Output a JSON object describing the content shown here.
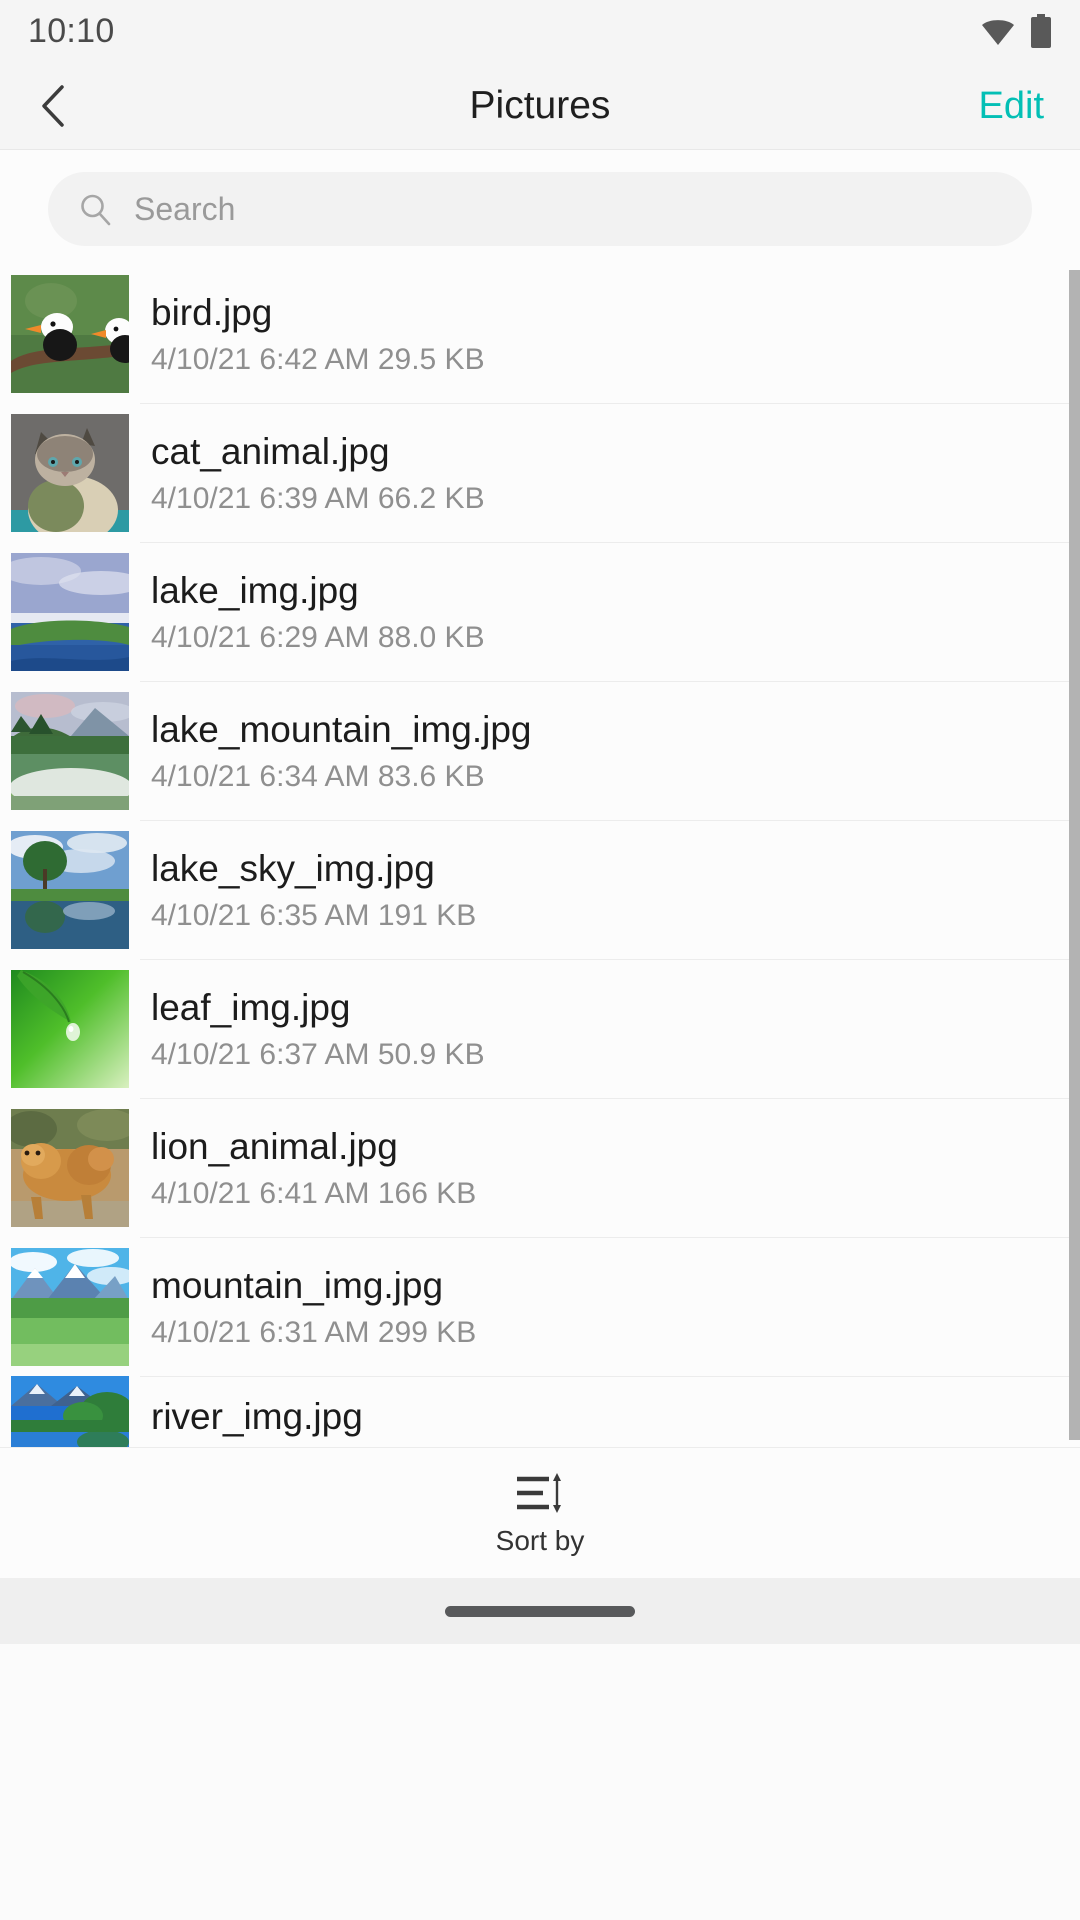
{
  "status_bar": {
    "time": "10:10",
    "wifi_icon": "wifi-icon",
    "battery_icon": "battery-full-icon"
  },
  "app_bar": {
    "back_icon": "back-chevron-icon",
    "title": "Pictures",
    "edit_label": "Edit",
    "accent_color": "#03bfb5"
  },
  "search": {
    "icon": "search-icon",
    "placeholder": "Search",
    "value": ""
  },
  "files": [
    {
      "name": "bird.jpg",
      "meta": "4/10/21 6:42 AM 29.5 KB",
      "date": "4/10/21",
      "time": "6:42 AM",
      "size": "29.5 KB",
      "thumb": "bird-thumbnail"
    },
    {
      "name": "cat_animal.jpg",
      "meta": "4/10/21 6:39 AM 66.2 KB",
      "date": "4/10/21",
      "time": "6:39 AM",
      "size": "66.2 KB",
      "thumb": "cat-thumbnail"
    },
    {
      "name": "lake_img.jpg",
      "meta": "4/10/21 6:29 AM 88.0 KB",
      "date": "4/10/21",
      "time": "6:29 AM",
      "size": "88.0 KB",
      "thumb": "lake-thumbnail"
    },
    {
      "name": "lake_mountain_img.jpg",
      "meta": "4/10/21 6:34 AM 83.6 KB",
      "date": "4/10/21",
      "time": "6:34 AM",
      "size": "83.6 KB",
      "thumb": "lake-mountain-thumbnail"
    },
    {
      "name": "lake_sky_img.jpg",
      "meta": "4/10/21 6:35 AM 191 KB",
      "date": "4/10/21",
      "time": "6:35 AM",
      "size": "191 KB",
      "thumb": "lake-sky-thumbnail"
    },
    {
      "name": "leaf_img.jpg",
      "meta": "4/10/21 6:37 AM 50.9 KB",
      "date": "4/10/21",
      "time": "6:37 AM",
      "size": "50.9 KB",
      "thumb": "leaf-thumbnail"
    },
    {
      "name": "lion_animal.jpg",
      "meta": "4/10/21 6:41 AM 166 KB",
      "date": "4/10/21",
      "time": "6:41 AM",
      "size": "166 KB",
      "thumb": "lion-thumbnail"
    },
    {
      "name": "mountain_img.jpg",
      "meta": "4/10/21 6:31 AM 299 KB",
      "date": "4/10/21",
      "time": "6:31 AM",
      "size": "299 KB",
      "thumb": "mountain-thumbnail"
    },
    {
      "name": "river_img.jpg",
      "meta": "",
      "date": "",
      "time": "",
      "size": "",
      "thumb": "river-thumbnail"
    }
  ],
  "bottom_bar": {
    "sort_icon": "sort-by-icon",
    "sort_label": "Sort by"
  },
  "nav_bar": {
    "handle": "home-gesture-handle"
  }
}
